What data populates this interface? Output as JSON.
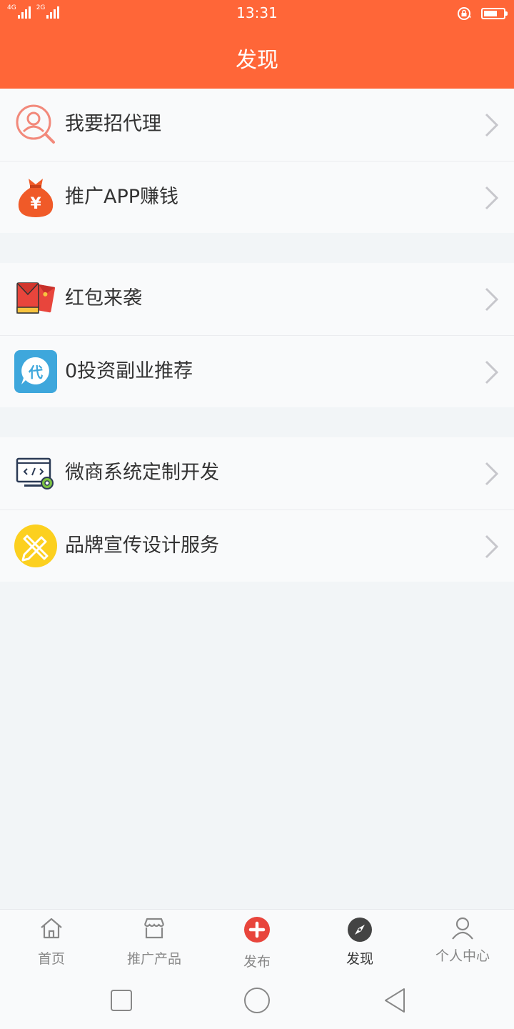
{
  "status_bar": {
    "time": "13:31",
    "signal_1_label": "4G",
    "signal_2_label": "2G",
    "battery_level": 0.7
  },
  "header": {
    "title": "发现"
  },
  "groups": [
    {
      "items": [
        {
          "label": "我要招代理",
          "icon": "agent-search-icon"
        },
        {
          "label": "推广APP赚钱",
          "icon": "money-bag-icon"
        }
      ]
    },
    {
      "items": [
        {
          "label": "红包来袭",
          "icon": "red-envelope-icon"
        },
        {
          "label": "0投资副业推荐",
          "icon": "dai-badge-icon"
        }
      ]
    },
    {
      "items": [
        {
          "label": "微商系统定制开发",
          "icon": "code-monitor-gear-icon"
        },
        {
          "label": "品牌宣传设计服务",
          "icon": "design-tools-icon"
        }
      ]
    }
  ],
  "tabbar": {
    "active": "发现",
    "tabs": [
      {
        "label": "首页",
        "icon": "home-icon"
      },
      {
        "label": "推广产品",
        "icon": "store-icon"
      },
      {
        "label": "发布",
        "icon": "plus-circle-icon"
      },
      {
        "label": "发现",
        "icon": "compass-icon"
      },
      {
        "label": "个人中心",
        "icon": "user-icon"
      }
    ]
  },
  "colors": {
    "brand": "#ff6638",
    "publish_red": "#e8453c",
    "chevron": "#c7c7cc"
  }
}
